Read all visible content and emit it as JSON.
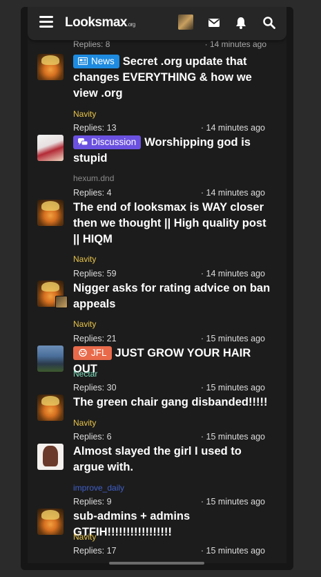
{
  "header": {
    "logo_text": "Looksmax",
    "logo_suffix": ".org",
    "icons": [
      "hamburger-icon",
      "envelope-icon",
      "bell-icon",
      "search-icon"
    ]
  },
  "cut_thread": {
    "replies": "Replies: 8",
    "time": "· 14 minutes ago"
  },
  "threads": [
    {
      "prefix": "News",
      "prefix_icon": "newspaper-icon",
      "title": "Secret .org update that changes EVERYTHING & how we view .org",
      "author": "Navity",
      "author_color": "#e8c44a",
      "replies": "Replies: 13",
      "time": "· 14 minutes ago"
    },
    {
      "prefix": "Discussion",
      "prefix_icon": "chat-bubbles-icon",
      "title": "Worshipping god is stupid",
      "author": "hexum.dnd",
      "author_color": "#8a8a8a",
      "replies": "Replies: 4",
      "time": "· 14 minutes ago"
    },
    {
      "title": "The end of looksmax is WAY closer then we thought || High quality post || HIQM",
      "author": "Navity",
      "author_color": "#e8c44a",
      "replies": "Replies: 59",
      "time": "· 14 minutes ago"
    },
    {
      "title": "Nigger asks for rating advice on ban appeals",
      "author": "Navity",
      "author_color": "#e8c44a",
      "replies": "Replies: 21",
      "time": "· 15 minutes ago"
    },
    {
      "prefix": "JFL",
      "prefix_icon": "laughing-face-icon",
      "title": "JUST GROW YOUR HAIR OUT",
      "author": "Nectar",
      "author_color": "#7fe0c0",
      "replies": "Replies: 30",
      "time": "· 15 minutes ago"
    },
    {
      "title": "The green chair gang disbanded!!!!!",
      "author": "Navity",
      "author_color": "#e8c44a",
      "replies": "Replies: 6",
      "time": "· 15 minutes ago"
    },
    {
      "title": "Almost slayed the girl I used to argue with.",
      "author": "improve_daily",
      "author_color": "#3f5fc8",
      "replies": "Replies: 9",
      "time": "· 15 minutes ago"
    },
    {
      "title": "sub-admins + admins GTFIH!!!!!!!!!!!!!!!!!",
      "author": "Navity",
      "author_color": "#e8c44a",
      "replies": "Replies: 17",
      "time": "· 15 minutes ago"
    }
  ],
  "colors": {
    "news": "#1e8be0",
    "discussion": "#6b51e0",
    "jfl": "#e86a4a",
    "background": "#1c1c1c"
  }
}
